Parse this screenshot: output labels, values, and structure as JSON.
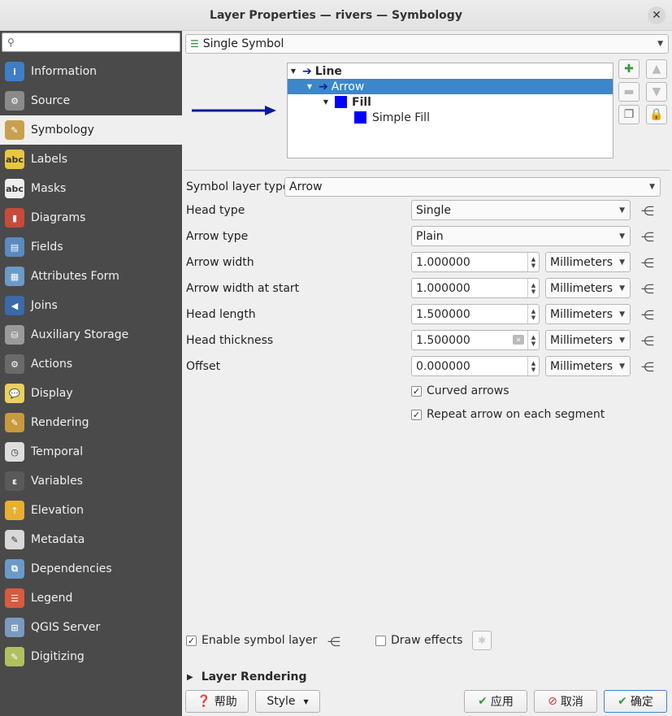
{
  "window": {
    "title": "Layer Properties — rivers — Symbology",
    "close_label": "✕"
  },
  "sidebar": {
    "search_placeholder": "",
    "items": [
      {
        "label": "Information",
        "icon": "info-icon",
        "color": "#3d7ec7",
        "glyph": "i"
      },
      {
        "label": "Source",
        "icon": "wrench-icon",
        "color": "#8a8a8a",
        "glyph": "⚙"
      },
      {
        "label": "Symbology",
        "icon": "paintbrush-icon",
        "color": "#c8a050",
        "glyph": "✎"
      },
      {
        "label": "Labels",
        "icon": "labels-abc-icon",
        "color": "#e8c640",
        "glyph": "abc"
      },
      {
        "label": "Masks",
        "icon": "masks-abc-icon",
        "color": "#eeeeee",
        "glyph": "abc"
      },
      {
        "label": "Diagrams",
        "icon": "diagrams-icon",
        "color": "#c84a3a",
        "glyph": "▮"
      },
      {
        "label": "Fields",
        "icon": "fields-icon",
        "color": "#5a8ac0",
        "glyph": "▤"
      },
      {
        "label": "Attributes Form",
        "icon": "attributes-form-icon",
        "color": "#6a9ac8",
        "glyph": "▦"
      },
      {
        "label": "Joins",
        "icon": "joins-icon",
        "color": "#3a6aa8",
        "glyph": "◀"
      },
      {
        "label": "Auxiliary Storage",
        "icon": "auxiliary-storage-icon",
        "color": "#9a9a9a",
        "glyph": "⛁"
      },
      {
        "label": "Actions",
        "icon": "actions-icon",
        "color": "#6a6a6a",
        "glyph": "⚙"
      },
      {
        "label": "Display",
        "icon": "display-icon",
        "color": "#e8d060",
        "glyph": "💬"
      },
      {
        "label": "Rendering",
        "icon": "rendering-icon",
        "color": "#c89a40",
        "glyph": "✎"
      },
      {
        "label": "Temporal",
        "icon": "temporal-icon",
        "color": "#dddddd",
        "glyph": "◷"
      },
      {
        "label": "Variables",
        "icon": "variables-icon",
        "color": "#5a5a5a",
        "glyph": "ε"
      },
      {
        "label": "Elevation",
        "icon": "elevation-icon",
        "color": "#e8b030",
        "glyph": "⇡"
      },
      {
        "label": "Metadata",
        "icon": "metadata-icon",
        "color": "#d8d8d8",
        "glyph": "✎"
      },
      {
        "label": "Dependencies",
        "icon": "dependencies-icon",
        "color": "#6a9ac8",
        "glyph": "⧉"
      },
      {
        "label": "Legend",
        "icon": "legend-icon",
        "color": "#d85a40",
        "glyph": "☰"
      },
      {
        "label": "QGIS Server",
        "icon": "qgis-server-icon",
        "color": "#7a9ac0",
        "glyph": "⊞"
      },
      {
        "label": "Digitizing",
        "icon": "digitizing-icon",
        "color": "#b0c060",
        "glyph": "✎"
      }
    ]
  },
  "renderer": {
    "value": "Single Symbol"
  },
  "symbol_tree": {
    "line": "Line",
    "arrow": "Arrow",
    "fill": "Fill",
    "simple_fill": "Simple Fill"
  },
  "symbol_layer_type": {
    "label": "Symbol layer type",
    "value": "Arrow"
  },
  "fields": {
    "head_type": {
      "label": "Head type",
      "value": "Single"
    },
    "arrow_type": {
      "label": "Arrow type",
      "value": "Plain"
    },
    "arrow_width": {
      "label": "Arrow width",
      "value": "1.000000",
      "unit": "Millimeters"
    },
    "arrow_width_start": {
      "label": "Arrow width at start",
      "value": "1.000000",
      "unit": "Millimeters"
    },
    "head_length": {
      "label": "Head length",
      "value": "1.500000",
      "unit": "Millimeters"
    },
    "head_thickness": {
      "label": "Head thickness",
      "value": "1.500000",
      "unit": "Millimeters"
    },
    "offset": {
      "label": "Offset",
      "value": "0.000000",
      "unit": "Millimeters"
    }
  },
  "checks": {
    "curved_arrows": {
      "label": "Curved arrows",
      "checked": true
    },
    "repeat_arrow": {
      "label": "Repeat arrow on each segment",
      "checked": true
    },
    "enable_symbol_layer": {
      "label": "Enable symbol layer",
      "checked": true
    },
    "draw_effects": {
      "label": "Draw effects",
      "checked": false
    }
  },
  "layer_rendering": {
    "label": "Layer Rendering"
  },
  "buttons": {
    "help": "帮助",
    "style": "Style",
    "apply": "应用",
    "cancel": "取消",
    "ok": "确定"
  },
  "colors": {
    "accent": "#3d86c8",
    "sidebar": "#4a4a4a",
    "arrow_blue": "#0a1a9a"
  }
}
